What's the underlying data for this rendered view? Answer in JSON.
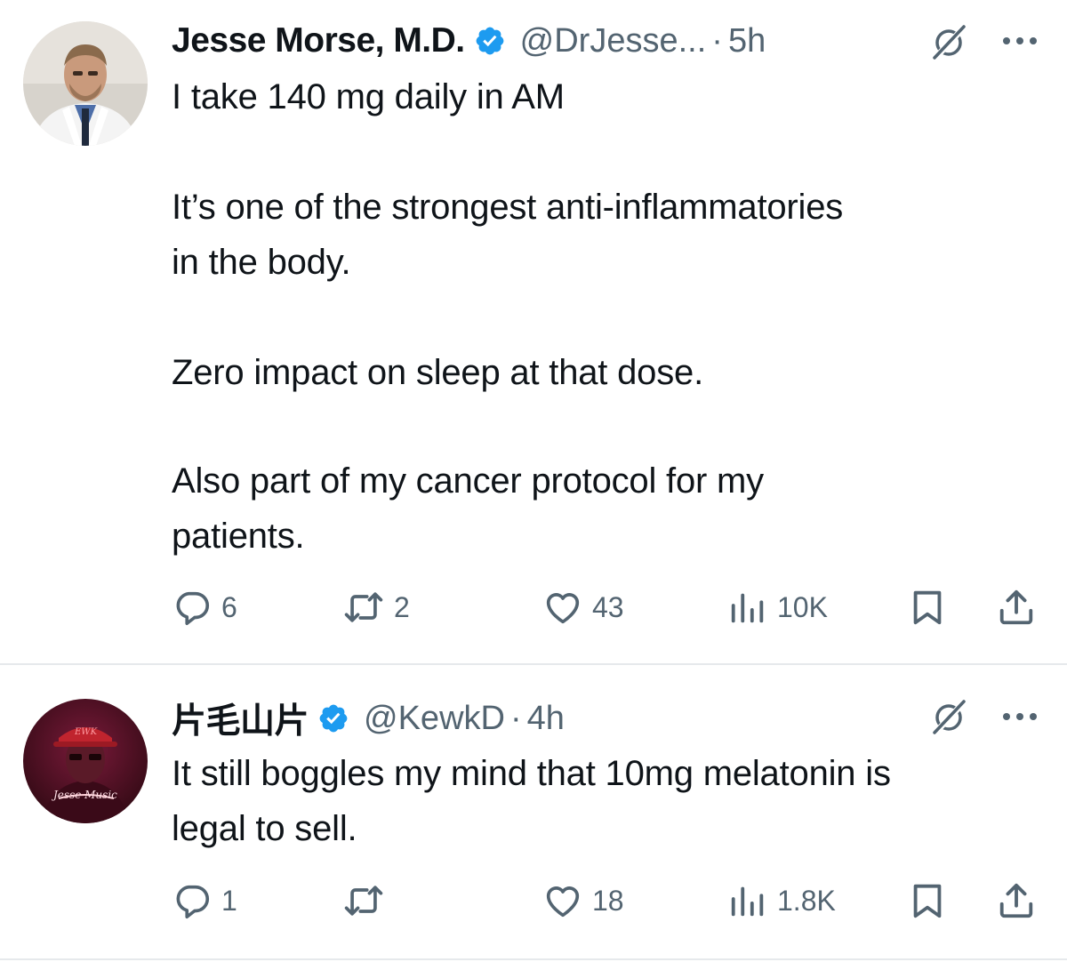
{
  "tweets": [
    {
      "name": "Jesse Morse, M.D.",
      "handle": "@DrJesse...",
      "separator": "·",
      "time": "5h",
      "verified": true,
      "lines": [
        "I take 140 mg daily in AM",
        "It’s one of the strongest anti-inflammatories",
        "in the body.",
        "Zero impact on sleep at that dose.",
        "Also part of my cancer protocol for my",
        "patients."
      ],
      "replies": "6",
      "reposts": "2",
      "likes": "43",
      "views": "10K"
    },
    {
      "name": "片毛山片",
      "handle": "@KewkD",
      "separator": "·",
      "time": "4h",
      "verified": true,
      "lines": [
        "It still boggles my mind that 10mg melatonin is",
        "legal to sell."
      ],
      "replies": "1",
      "reposts": "",
      "likes": "18",
      "views": "1.8K"
    }
  ],
  "colors": {
    "text": "#0f1419",
    "secondary": "#536471",
    "verified": "#1d9bf0",
    "divider": "#e6e9ec"
  },
  "icons": [
    "verified-badge-icon",
    "grok-icon",
    "more-icon",
    "reply-icon",
    "repost-icon",
    "like-icon",
    "views-icon",
    "bookmark-icon",
    "share-icon"
  ]
}
